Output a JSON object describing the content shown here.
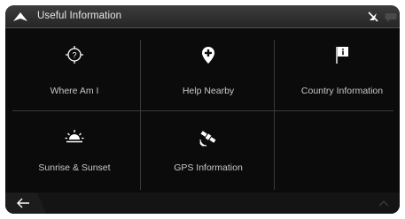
{
  "header": {
    "title": "Useful Information"
  },
  "tiles": [
    {
      "label": "Where Am I",
      "icon": "where-am-i-icon"
    },
    {
      "label": "Help Nearby",
      "icon": "help-nearby-icon"
    },
    {
      "label": "Country Information",
      "icon": "country-info-icon"
    },
    {
      "label": "Sunrise & Sunset",
      "icon": "sunrise-icon"
    },
    {
      "label": "GPS Information",
      "icon": "satellite-icon"
    }
  ],
  "footer": {
    "back_icon": "back-arrow-icon",
    "more_icon": "chevron-up-icon"
  },
  "colors": {
    "background": "#0b0b0b",
    "header": "#303030",
    "text": "#c8c8c8",
    "divider": "#3a3a3a"
  }
}
